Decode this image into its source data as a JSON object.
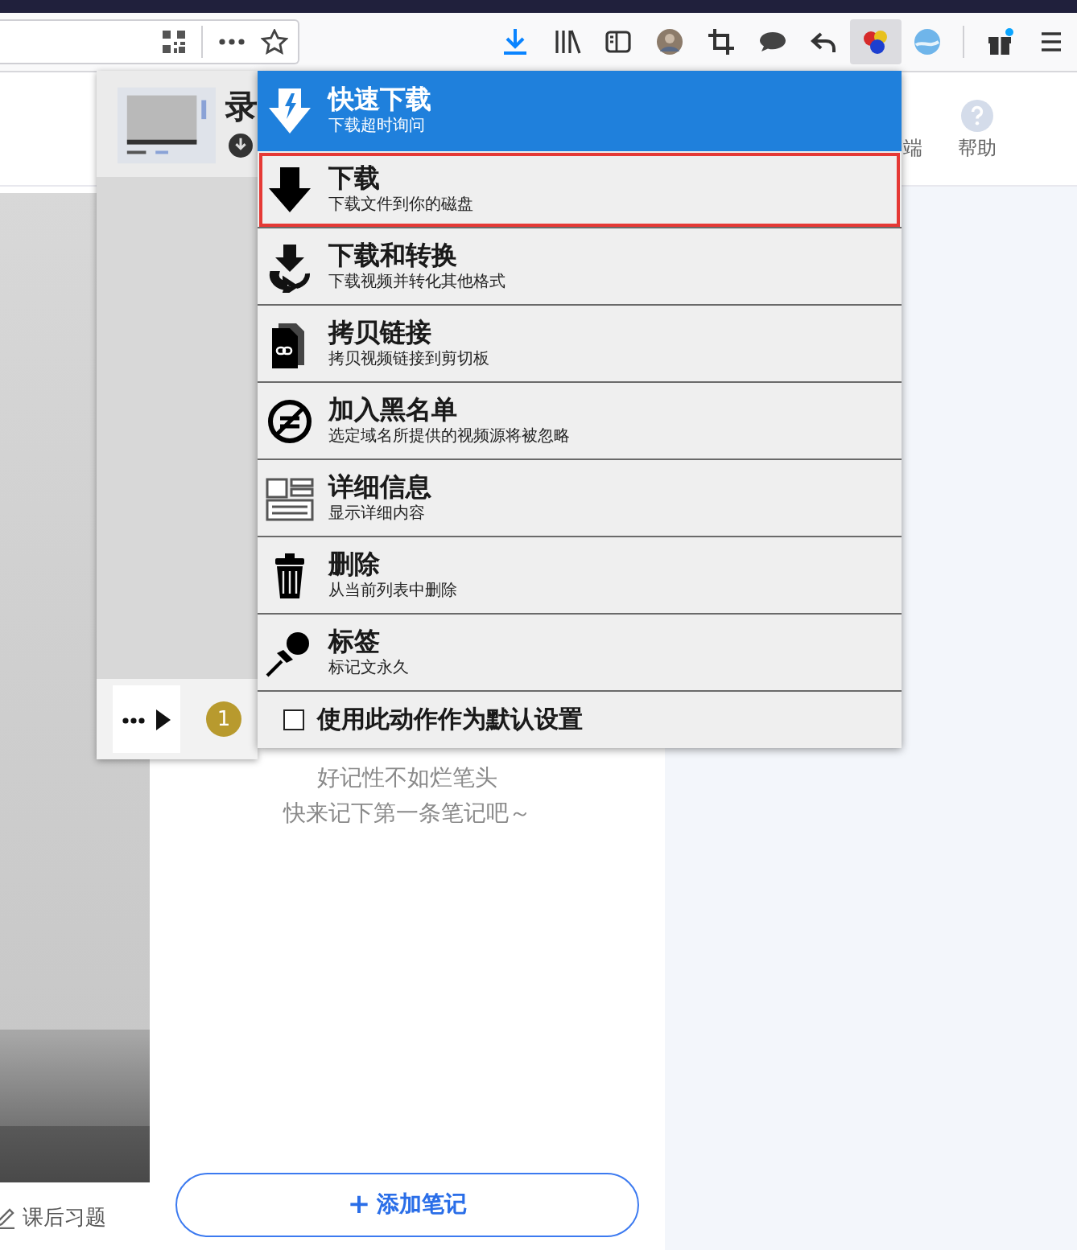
{
  "header": {
    "partial_label": "端",
    "help": "帮助"
  },
  "notes": {
    "empty_lines": [
      "好记性不如烂笔头",
      "快来记下第一条笔记吧～"
    ],
    "add_button": {
      "icon": "+",
      "label": "添加笔记"
    }
  },
  "lesson_tab": "课后习题",
  "media_popup": {
    "title": "录",
    "count": "1"
  },
  "menu": {
    "items": [
      {
        "kind": "quick",
        "title": "快速下载",
        "subtitle": "下载超时询问",
        "selected": false
      },
      {
        "kind": "download",
        "title": "下载",
        "subtitle": "下载文件到你的磁盘",
        "selected": true
      },
      {
        "kind": "convert",
        "title": "下载和转换",
        "subtitle": "下载视频并转化其他格式",
        "selected": false
      },
      {
        "kind": "copy",
        "title": "拷贝链接",
        "subtitle": "拷贝视频链接到剪切板",
        "selected": false
      },
      {
        "kind": "blacklist",
        "title": "加入黑名单",
        "subtitle": "选定域名所提供的视频源将被忽略",
        "selected": false
      },
      {
        "kind": "details",
        "title": "详细信息",
        "subtitle": "显示详细内容",
        "selected": false
      },
      {
        "kind": "delete",
        "title": "删除",
        "subtitle": "从当前列表中删除",
        "selected": false
      },
      {
        "kind": "pin",
        "title": "标签",
        "subtitle": "标记文永久",
        "selected": false
      }
    ],
    "default_option": {
      "label": "使用此动作作为默认设置",
      "checked": false
    }
  }
}
